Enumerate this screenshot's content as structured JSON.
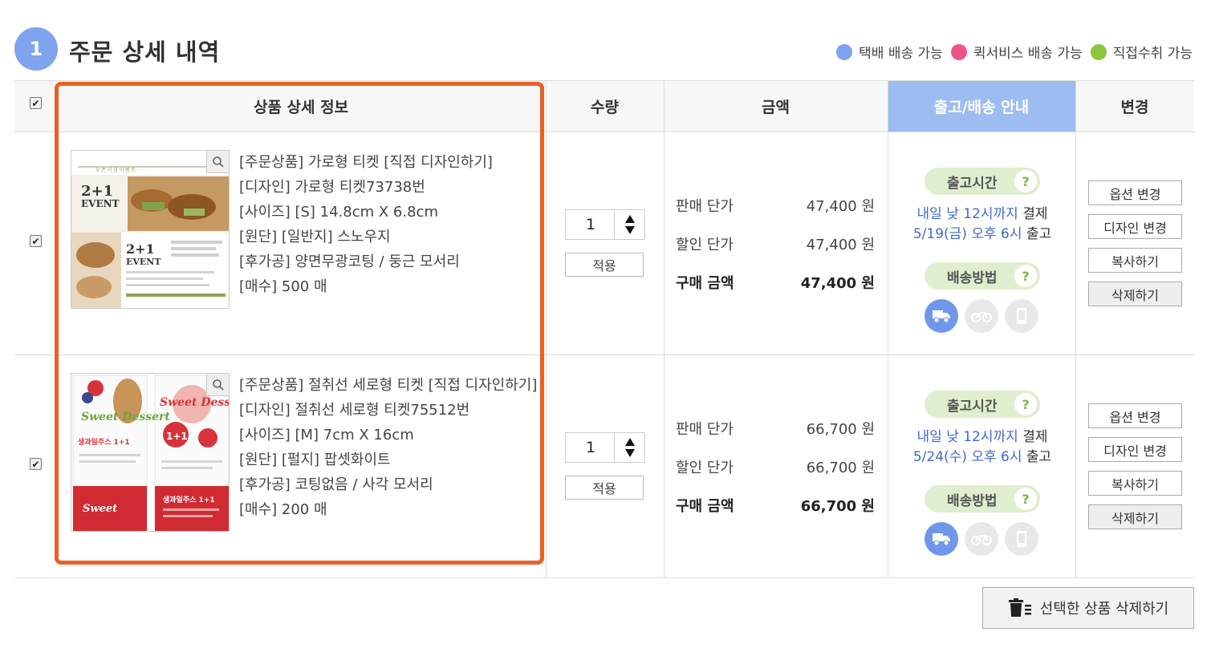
{
  "header": {
    "step_number": "1",
    "title": "주문 상세 내역",
    "legend": [
      {
        "label": "택배 배송 가능",
        "color": "#7fa3ee"
      },
      {
        "label": "퀵서비스 배송 가능",
        "color": "#ee5586"
      },
      {
        "label": "직접수취 가능",
        "color": "#8cc63e"
      }
    ]
  },
  "table": {
    "columns": {
      "product": "상품 상세 정보",
      "quantity": "수량",
      "amount": "금액",
      "shipping": "출고/배송 안내",
      "change": "변경"
    }
  },
  "orders": [
    {
      "checked": true,
      "thumbnail": {
        "headline_top": "2+1",
        "headline_event": "EVENT",
        "headline_bottom": "2+1",
        "headline_bottom_event": "EVENT"
      },
      "info": [
        "[주문상품] 가로형 티켓 [직접 디자인하기]",
        "[디자인] 가로형 티켓73738번",
        "[사이즈] [S] 14.8cm X 6.8cm",
        "[원단] [일반지] 스노우지",
        "[후가공] 양면무광코팅 / 둥근 모서리",
        "[매수] 500 매"
      ],
      "quantity": "1",
      "apply_label": "적용",
      "prices": {
        "sale_label": "판매 단가",
        "sale_value": "47,400 원",
        "discount_label": "할인 단가",
        "discount_value": "47,400 원",
        "total_label": "구매 금액",
        "total_value": "47,400 원"
      },
      "shipping": {
        "time_label": "출고시간",
        "deadline": "내일 낮 12시까지",
        "deadline_suffix": " 결제",
        "ship_date": "5/19(금) 오후 6시",
        "ship_suffix": " 출고",
        "method_label": "배송방법"
      },
      "actions": [
        "옵션 변경",
        "디자인 변경",
        "복사하기",
        "삭제하기"
      ]
    },
    {
      "checked": true,
      "thumbnail": {
        "title_left": "Sweet Dessert",
        "title_right": "Sweet Dessert",
        "promo_left": "생과일주스 1+1",
        "promo_right": "1+1",
        "footer_right": "생과일주스 1+1"
      },
      "info": [
        "[주문상품] 절취선 세로형 티켓 [직접 디자인하기]",
        "[디자인] 절취선 세로형 티켓75512번",
        "[사이즈] [M] 7cm X 16cm",
        "[원단] [펄지] 팝셋화이트",
        "[후가공] 코팅없음 / 사각 모서리",
        "[매수] 200 매"
      ],
      "quantity": "1",
      "apply_label": "적용",
      "prices": {
        "sale_label": "판매 단가",
        "sale_value": "66,700 원",
        "discount_label": "할인 단가",
        "discount_value": "66,700 원",
        "total_label": "구매 금액",
        "total_value": "66,700 원"
      },
      "shipping": {
        "time_label": "출고시간",
        "deadline": "내일 낮 12시까지",
        "deadline_suffix": " 결제",
        "ship_date": "5/24(수) 오후 6시",
        "ship_suffix": " 출고",
        "method_label": "배송방법"
      },
      "actions": [
        "옵션 변경",
        "디자인 변경",
        "복사하기",
        "삭제하기"
      ]
    }
  ],
  "footer": {
    "delete_selected": "선택한 상품 삭제하기"
  },
  "icons": {
    "step": "step-number-badge",
    "zoom": "magnifier-icon",
    "qty": "up-down-arrows-icon",
    "courier": "truck-icon",
    "quick": "motorcycle-icon",
    "pickup": "phone-pickup-icon",
    "trash": "trash-list-icon"
  }
}
